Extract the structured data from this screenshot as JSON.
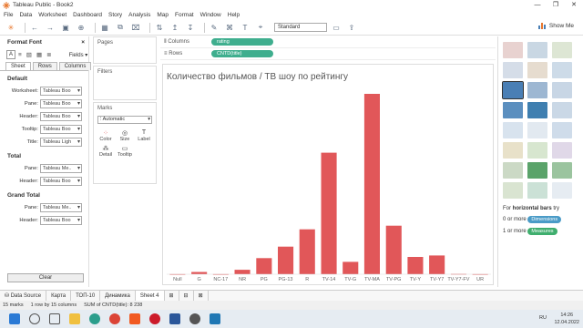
{
  "window": {
    "title": "Tableau Public - Book2",
    "controls": [
      "—",
      "❐",
      "✕"
    ]
  },
  "menu": [
    "File",
    "Data",
    "Worksheet",
    "Dashboard",
    "Story",
    "Analysis",
    "Map",
    "Format",
    "Window",
    "Help"
  ],
  "toolbar": {
    "fit_value": "Standard",
    "show_me_label": "Show Me"
  },
  "format_panel": {
    "title": "Format Font",
    "close": "×",
    "fields_label": "Fields",
    "tabs": [
      "Sheet",
      "Rows",
      "Columns"
    ],
    "sections": {
      "default": {
        "title": "Default",
        "rows": [
          {
            "label": "Worksheet:",
            "value": "Tableau Boo"
          },
          {
            "label": "Pane:",
            "value": "Tableau Boo"
          },
          {
            "label": "Header:",
            "value": "Tableau Boo"
          },
          {
            "label": "Tooltip:",
            "value": "Tableau Boo"
          },
          {
            "label": "Title:",
            "value": "Tableau Ligh"
          }
        ]
      },
      "total": {
        "title": "Total",
        "rows": [
          {
            "label": "Pane:",
            "value": "Tableau Me.."
          },
          {
            "label": "Header:",
            "value": "Tableau Boo"
          }
        ]
      },
      "grand_total": {
        "title": "Grand Total",
        "rows": [
          {
            "label": "Pane:",
            "value": "Tableau Me.."
          },
          {
            "label": "Header:",
            "value": "Tableau Boo"
          }
        ]
      }
    },
    "clear_label": "Clear"
  },
  "cards": {
    "pages": "Pages",
    "filters": "Filters",
    "marks": "Marks",
    "marks_type": "Automatic",
    "mark_buttons": [
      "Color",
      "Size",
      "Label",
      "Detail",
      "Tooltip"
    ]
  },
  "shelves": {
    "columns_label": "Columns",
    "columns_pill": "rating",
    "rows_label": "Rows",
    "rows_pill": "CNTD(title)"
  },
  "chart_data": {
    "type": "bar",
    "title": "Количество фильмов / ТВ шоу по рейтингу",
    "categories": [
      "Null",
      "G",
      "NC-17",
      "NR",
      "PG",
      "PG-13",
      "R",
      "TV-14",
      "TV-G",
      "TV-MA",
      "TV-PG",
      "TV-Y",
      "TV-Y7",
      "TV-Y7-FV",
      "UR"
    ],
    "values": [
      4,
      41,
      3,
      80,
      287,
      490,
      799,
      2160,
      220,
      3207,
      863,
      307,
      334,
      6,
      3
    ],
    "bar_color": "#e15759"
  },
  "show_me": {
    "hint_prefix": "For",
    "hint_bold": "horizontal bars",
    "hint_suffix": "try",
    "line1_prefix": "0 or more",
    "line1_tag": "Dimensions",
    "line2_prefix": "1 or more",
    "line2_tag": "Measures",
    "tag_dim_color": "#4a9bc7",
    "tag_meas_color": "#3fae6e"
  },
  "sheet_tabs": [
    "Data Source",
    "Карта",
    "ТОП-10",
    "Динамика",
    "Sheet 4"
  ],
  "status": [
    "15 marks",
    "1 row by 15 columns",
    "SUM of CNTD(title): 8 238"
  ],
  "taskbar": {
    "lang": "RU",
    "time": "14:26",
    "date": "12.04.2022"
  }
}
